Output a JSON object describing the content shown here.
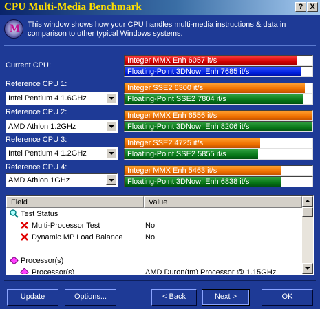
{
  "window": {
    "title": "CPU Multi-Media Benchmark",
    "help_label": "?",
    "close_label": "X"
  },
  "header": {
    "icon": "benchmark-app-icon",
    "icon_glyph": "M",
    "description": "This window shows how your CPU handles multi-media instructions & data in comparison to other typical Windows systems."
  },
  "cpus": [
    {
      "label": "Current CPU:",
      "selected": "",
      "results": [
        {
          "text": "Integer MMX Enh 6057 it/s",
          "value": 6057,
          "color": "#e00000",
          "fill": 0.92
        },
        {
          "text": "Floating-Point 3DNow! Enh 7685 it/s",
          "value": 7685,
          "color": "#0020f0",
          "fill": 0.94
        }
      ]
    },
    {
      "label": "Reference CPU 1:",
      "selected": "Intel Pentium 4 1.6GHz",
      "results": [
        {
          "text": "Integer SSE2 6300 it/s",
          "value": 6300,
          "color": "#f07800",
          "fill": 0.96
        },
        {
          "text": "Floating-Point SSE2 7804 it/s",
          "value": 7804,
          "color": "#108020",
          "fill": 0.95
        }
      ]
    },
    {
      "label": "Reference CPU 2:",
      "selected": "AMD Athlon 1.2GHz",
      "results": [
        {
          "text": "Integer MMX Enh 6556 it/s",
          "value": 6556,
          "color": "#f07800",
          "fill": 1.0
        },
        {
          "text": "Floating-Point 3DNow! Enh 8206 it/s",
          "value": 8206,
          "color": "#108020",
          "fill": 1.0
        }
      ]
    },
    {
      "label": "Reference CPU 3:",
      "selected": "Intel Pentium 4 1.2GHz",
      "results": [
        {
          "text": "Integer SSE2 4725 it/s",
          "value": 4725,
          "color": "#f07800",
          "fill": 0.72
        },
        {
          "text": "Floating-Point SSE2 5855 it/s",
          "value": 5855,
          "color": "#108020",
          "fill": 0.71
        }
      ]
    },
    {
      "label": "Reference CPU 4:",
      "selected": "AMD Athlon 1GHz",
      "results": [
        {
          "text": "Integer MMX Enh 5463 it/s",
          "value": 5463,
          "color": "#f07800",
          "fill": 0.83
        },
        {
          "text": "Floating-Point 3DNow! Enh 6838 it/s",
          "value": 6838,
          "color": "#108020",
          "fill": 0.83
        }
      ]
    }
  ],
  "list": {
    "columns": [
      "Field",
      "Value"
    ],
    "rows": [
      {
        "field": "Test Status",
        "value": "",
        "icon": "magnifier-icon"
      },
      {
        "field": "Multi-Processor Test",
        "value": "No",
        "icon": "red-x-icon"
      },
      {
        "field": "Dynamic MP Load Balance",
        "value": "No",
        "icon": "red-x-icon"
      },
      {
        "field": "",
        "value": "",
        "icon": ""
      },
      {
        "field": "Processor(s)",
        "value": "",
        "icon": "pink-diamond-icon"
      },
      {
        "field": "Processor(s)",
        "value": "AMD Duron(tm) Processor @ 1.15GHz",
        "icon": "pink-diamond-icon"
      }
    ]
  },
  "buttons": {
    "update": "Update",
    "options": "Options...",
    "back": "< Back",
    "next": "Next >",
    "ok": "OK"
  }
}
